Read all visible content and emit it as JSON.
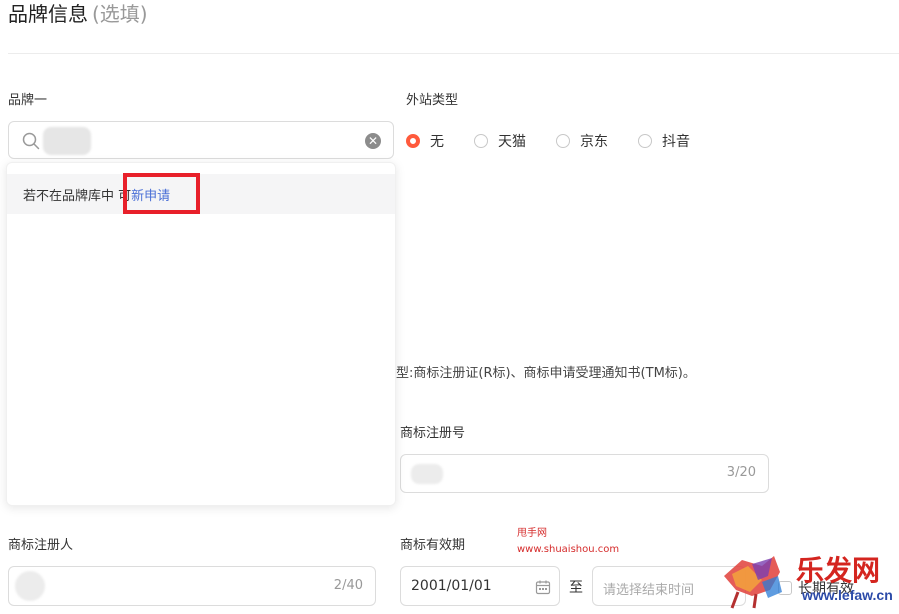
{
  "section": {
    "title": "品牌信息",
    "hint": "(选填)"
  },
  "brand": {
    "label": "品牌一",
    "clear_icon": "clear-circle-icon"
  },
  "dropdown": {
    "not_found_text": "若不在品牌库中",
    "apply_prefix": "可",
    "apply_link": "新申请"
  },
  "site_type": {
    "label": "外站类型",
    "options": [
      {
        "label": "无",
        "checked": true
      },
      {
        "label": "天猫",
        "checked": false
      },
      {
        "label": "京东",
        "checked": false
      },
      {
        "label": "抖音",
        "checked": false
      }
    ]
  },
  "notice_text": "型:商标注册证(R标)、商标申请受理通知书(TM标)。",
  "trademark_number": {
    "label": "商标注册号",
    "counter": "3/20"
  },
  "registrant": {
    "label": "商标注册人",
    "counter": "2/40"
  },
  "validity": {
    "label": "商标有效期",
    "start": "2001/01/01",
    "separator": "至",
    "end_placeholder": "请选择结束时间",
    "long_term": "长期有效"
  },
  "watermark": {
    "name": "甩手网",
    "url": "www.shuaishou.com",
    "logo_text": "乐发网",
    "logo_url": "www.lefaw.cn"
  },
  "colors": {
    "accent": "#ff5a3c",
    "link": "#4a6fd6",
    "highlight": "#e8202a"
  }
}
